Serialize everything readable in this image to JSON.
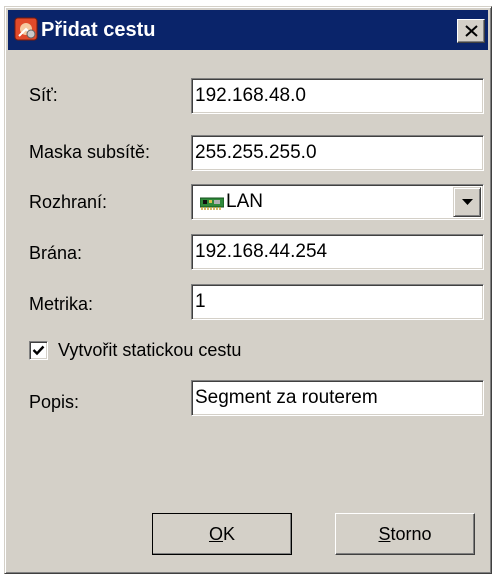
{
  "window": {
    "title": "Přidat cestu",
    "icon": "route-app-icon",
    "close_icon": "close-icon"
  },
  "form": {
    "network": {
      "label": "Síť:",
      "value": "192.168.48.0"
    },
    "mask": {
      "label": "Maska subsítě:",
      "value": "255.255.255.0"
    },
    "interface": {
      "label": "Rozhraní:",
      "value": "LAN",
      "icon": "network-card-icon"
    },
    "gateway": {
      "label": "Brána:",
      "value": "192.168.44.254"
    },
    "metric": {
      "label": "Metrika:",
      "value": "1"
    },
    "static_route": {
      "label": "Vytvořit statickou cestu",
      "checked": true
    },
    "description": {
      "label": "Popis:",
      "value": "Segment za routerem"
    }
  },
  "buttons": {
    "ok": {
      "mnemonic": "O",
      "rest": "K"
    },
    "cancel": {
      "mnemonic": "S",
      "rest": "torno"
    }
  },
  "colors": {
    "titlebar": "#0a246a",
    "dialog_bg": "#d4d0c8",
    "title_text": "#ffffff"
  }
}
